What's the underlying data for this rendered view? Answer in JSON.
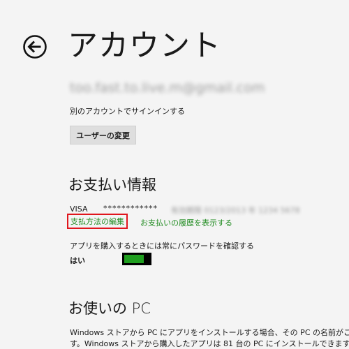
{
  "header": {
    "title": "アカウント",
    "back_icon": "back-arrow-icon"
  },
  "account": {
    "email": "too.fast.to.live.m@gmail.com",
    "signin_text": "別のアカウントでサインインする",
    "change_user_label": "ユーザーの変更"
  },
  "payment": {
    "heading": "お支払い情報",
    "card_type": "VISA",
    "card_number": "************",
    "card_details": "有効期限 0123/2013 年   1234 5678",
    "edit_link": "支払方法の編集",
    "history_link": "お支払いの履歴を表示する",
    "password_label": "アプリを購入するときには常にパスワードを確認する",
    "password_state": "はい",
    "password_toggle_on": true,
    "link_color": "#1e8a1e",
    "highlight_color": "#e0161d",
    "toggle_color": "#1f9e1f"
  },
  "pcs": {
    "heading": "お使いの PC",
    "line1": "Windows ストアから PC にアプリをインストールする場合、その PC の名前がここに表示されま",
    "line2": "す。Windows ストアから購入したアプリは 81 台の PC にインストールできます。"
  }
}
